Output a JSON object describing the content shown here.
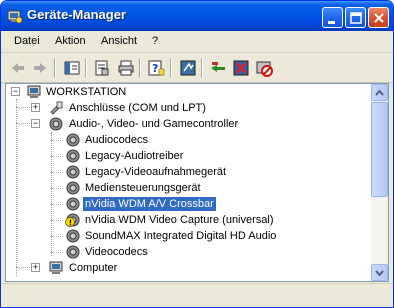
{
  "window": {
    "title": "Geräte-Manager",
    "accent": "#0055e5"
  },
  "menu": {
    "items": [
      "Datei",
      "Aktion",
      "Ansicht",
      "?"
    ]
  },
  "toolbar": {
    "tools": [
      "back-arrow-icon",
      "forward-arrow-icon",
      "show-hide-console-tree-icon",
      "properties-icon",
      "print-icon",
      "help-icon",
      "scan-hardware-icon",
      "update-driver-icon",
      "uninstall-icon",
      "disable-icon"
    ]
  },
  "tree": {
    "root": "WORKSTATION",
    "nodes": [
      {
        "label": "Anschlüsse (COM und LPT)",
        "expanded": false
      },
      {
        "label": "Audio-, Video- und Gamecontroller",
        "expanded": true
      },
      {
        "label": "Audiocodecs"
      },
      {
        "label": "Legacy-Audiotreiber"
      },
      {
        "label": "Legacy-Videoaufnahmegerät"
      },
      {
        "label": "Mediensteuerungsgerät"
      },
      {
        "label": "nVidia WDM A/V Crossbar",
        "selected": true
      },
      {
        "label": "nVidia WDM Video Capture (universal)",
        "warning": true
      },
      {
        "label": "SoundMAX Integrated Digital HD Audio"
      },
      {
        "label": "Videocodecs"
      },
      {
        "label": "Computer",
        "expanded": false
      }
    ]
  },
  "colors": {
    "selection": "#316ac5",
    "close_button": "#d8532e"
  }
}
